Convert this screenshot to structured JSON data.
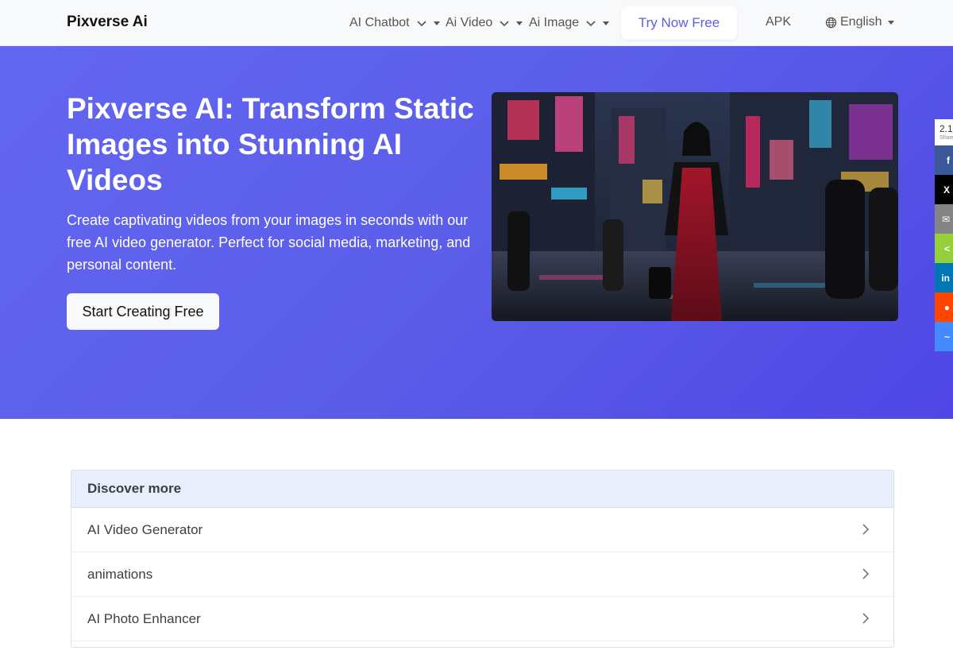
{
  "navbar": {
    "brand": "Pixverse Ai",
    "menu": [
      {
        "label": "AI Chatbot"
      },
      {
        "label": "Ai Video"
      },
      {
        "label": "Ai Image"
      }
    ],
    "try_label": "Try Now Free",
    "apk_label": "APK",
    "lang_label": "English"
  },
  "hero": {
    "title": "Pixverse AI: Transform Static Images into Stunning AI Videos",
    "subtitle": "Create captivating videos from your images in seconds with our free AI video generator. Perfect for social media, marketing, and personal content.",
    "cta_label": "Start Creating Free",
    "colors": {
      "gradient_start": "#6366f1",
      "gradient_end": "#4f46e5"
    }
  },
  "share": {
    "count": "2.1",
    "count_label": "Shares",
    "buttons": [
      {
        "icon": "facebook-icon",
        "glyph": "f",
        "color": "#3b5998"
      },
      {
        "icon": "x-icon",
        "glyph": "X",
        "color": "#000000"
      },
      {
        "icon": "email-icon",
        "glyph": "✉",
        "color": "#848484"
      },
      {
        "icon": "sharethis-icon",
        "glyph": "<",
        "color": "#95d03a"
      },
      {
        "icon": "linkedin-icon",
        "glyph": "in",
        "color": "#0077b5"
      },
      {
        "icon": "reddit-icon",
        "glyph": "●",
        "color": "#ff4500"
      },
      {
        "icon": "messenger-icon",
        "glyph": "~",
        "color": "#448aff"
      }
    ]
  },
  "discover": {
    "heading": "Discover more",
    "items": [
      {
        "label": "AI Video Generator"
      },
      {
        "label": "animations"
      },
      {
        "label": "AI Photo Enhancer"
      }
    ]
  }
}
